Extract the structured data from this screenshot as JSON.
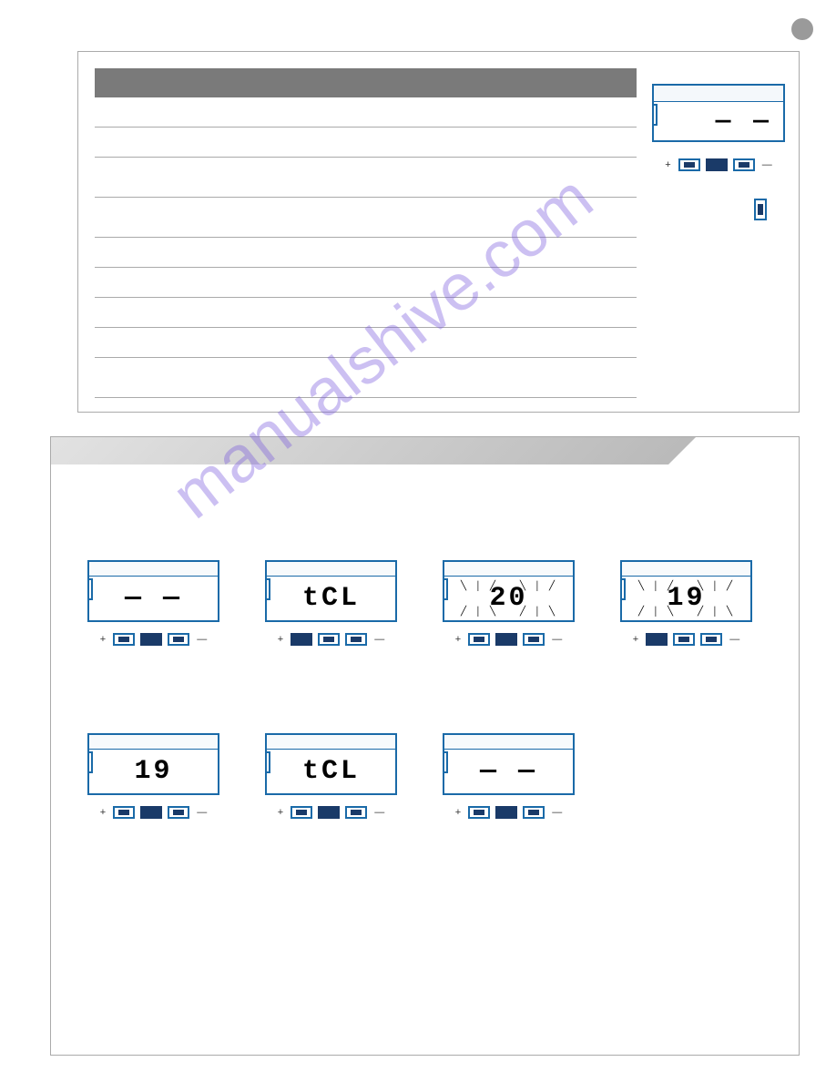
{
  "watermark": "manualshive.com",
  "side_display": {
    "value": "— —",
    "plus": "+",
    "minus": "—"
  },
  "displays": {
    "row1": [
      {
        "value": "— —",
        "flashing": false
      },
      {
        "value": "tCL",
        "flashing": false
      },
      {
        "value": "20",
        "flashing": true
      },
      {
        "value": "19",
        "flashing": true
      }
    ],
    "row2": [
      {
        "value": "19",
        "flashing": false
      },
      {
        "value": "tCL",
        "flashing": false
      },
      {
        "value": "— —",
        "flashing": false
      }
    ]
  },
  "button_labels": {
    "plus": "+",
    "minus": "—"
  }
}
